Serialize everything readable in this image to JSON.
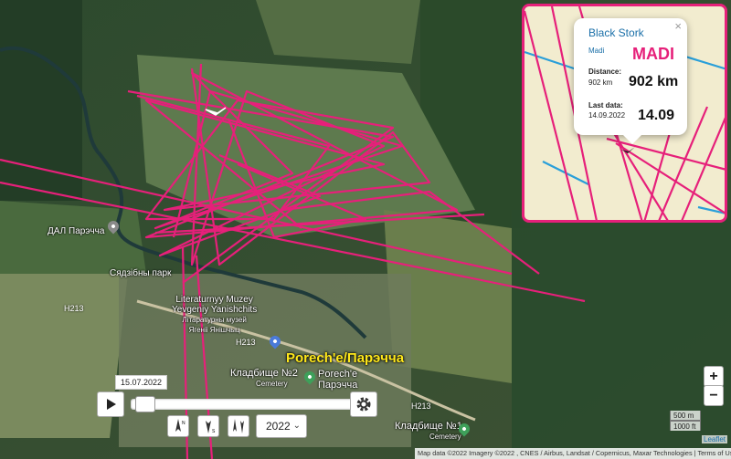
{
  "map": {
    "places": {
      "dal": "ДАЛ Парэчча",
      "park": "Сядзібны парк",
      "museum_1": "Literaturnyy Muzey",
      "museum_2": "Yevgeniy Yanishchits",
      "museum_3": "Літаратурны музей",
      "museum_4": "Ягенii Янішчыц",
      "town": "Porech'e/Парэчча",
      "cemetery_2": "Кладбище №2",
      "cemetery_2_sub": "Cemetery",
      "poreche_1": "Porech'e",
      "poreche_2": "Парэчча",
      "cemetery_1": "Кладбище №1",
      "cemetery_1_sub": "Cemetery"
    },
    "roads": [
      "H213",
      "H213",
      "H213"
    ],
    "track_color": "#e6207a"
  },
  "inset": {
    "species": "Black Stork",
    "name_small": "Madi",
    "name_big": "MADI",
    "distance_label": "Distance:",
    "distance_small": "902 km",
    "distance_big": "902 km",
    "last_label": "Last data:",
    "last_small": "14.09.2022",
    "last_big": "14.09",
    "close": "×",
    "accent": "#e6207a"
  },
  "controls": {
    "zoom_in": "+",
    "zoom_out": "−",
    "scale_m": "500 m",
    "scale_ft": "1000 ft",
    "leaflet": "Leaflet",
    "attribution": "Map data ©2022 Imagery ©2022 , CNES / Airbus, Landsat / Copernicus, Maxar Technologies",
    "terms": "Terms of Use",
    "date": "15.07.2022",
    "year": "2022",
    "timeline_position": 0.02
  }
}
